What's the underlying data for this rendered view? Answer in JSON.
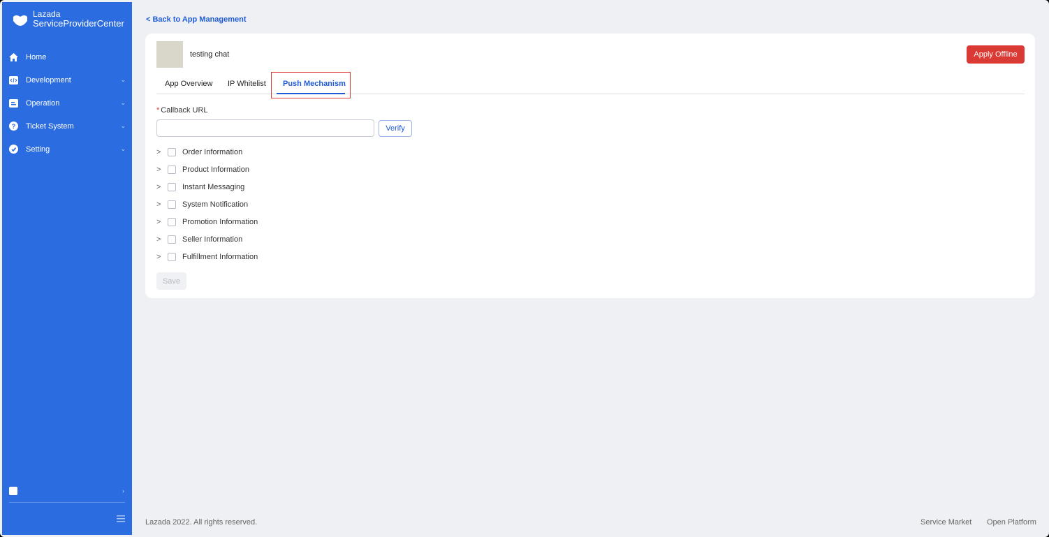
{
  "brand": {
    "line1": "Lazada",
    "line2": "ServiceProviderCenter"
  },
  "sidebar": {
    "items": [
      {
        "label": "Home",
        "icon": "home-icon",
        "has_submenu": false
      },
      {
        "label": "Development",
        "icon": "code-icon",
        "has_submenu": true
      },
      {
        "label": "Operation",
        "icon": "operation-icon",
        "has_submenu": true
      },
      {
        "label": "Ticket System",
        "icon": "question-icon",
        "has_submenu": true
      },
      {
        "label": "Setting",
        "icon": "settings-icon",
        "has_submenu": true
      }
    ]
  },
  "back_link": "< Back to App Management",
  "app": {
    "name": "testing chat",
    "apply_offline": "Apply Offline"
  },
  "tabs": [
    {
      "label": "App Overview",
      "active": false
    },
    {
      "label": "IP Whitelist",
      "active": false
    },
    {
      "label": "Push Mechanism",
      "active": true
    }
  ],
  "callback": {
    "required_mark": "*",
    "label": "Callback URL",
    "value": "",
    "placeholder": "",
    "verify_label": "Verify"
  },
  "sections": [
    {
      "label": "Order Information",
      "checked": false
    },
    {
      "label": "Product Information",
      "checked": false
    },
    {
      "label": "Instant Messaging",
      "checked": false
    },
    {
      "label": "System Notification",
      "checked": false
    },
    {
      "label": "Promotion Information",
      "checked": false
    },
    {
      "label": "Seller Information",
      "checked": false
    },
    {
      "label": "Fulfillment Information",
      "checked": false
    }
  ],
  "save_label": "Save",
  "footer": {
    "copyright": "Lazada 2022. All rights reserved.",
    "links": [
      "Service Market",
      "Open Platform"
    ]
  },
  "colors": {
    "sidebar_bg": "#2b6de0",
    "accent": "#1f5bd6",
    "danger": "#d93a33",
    "page_bg": "#eff0f4"
  }
}
